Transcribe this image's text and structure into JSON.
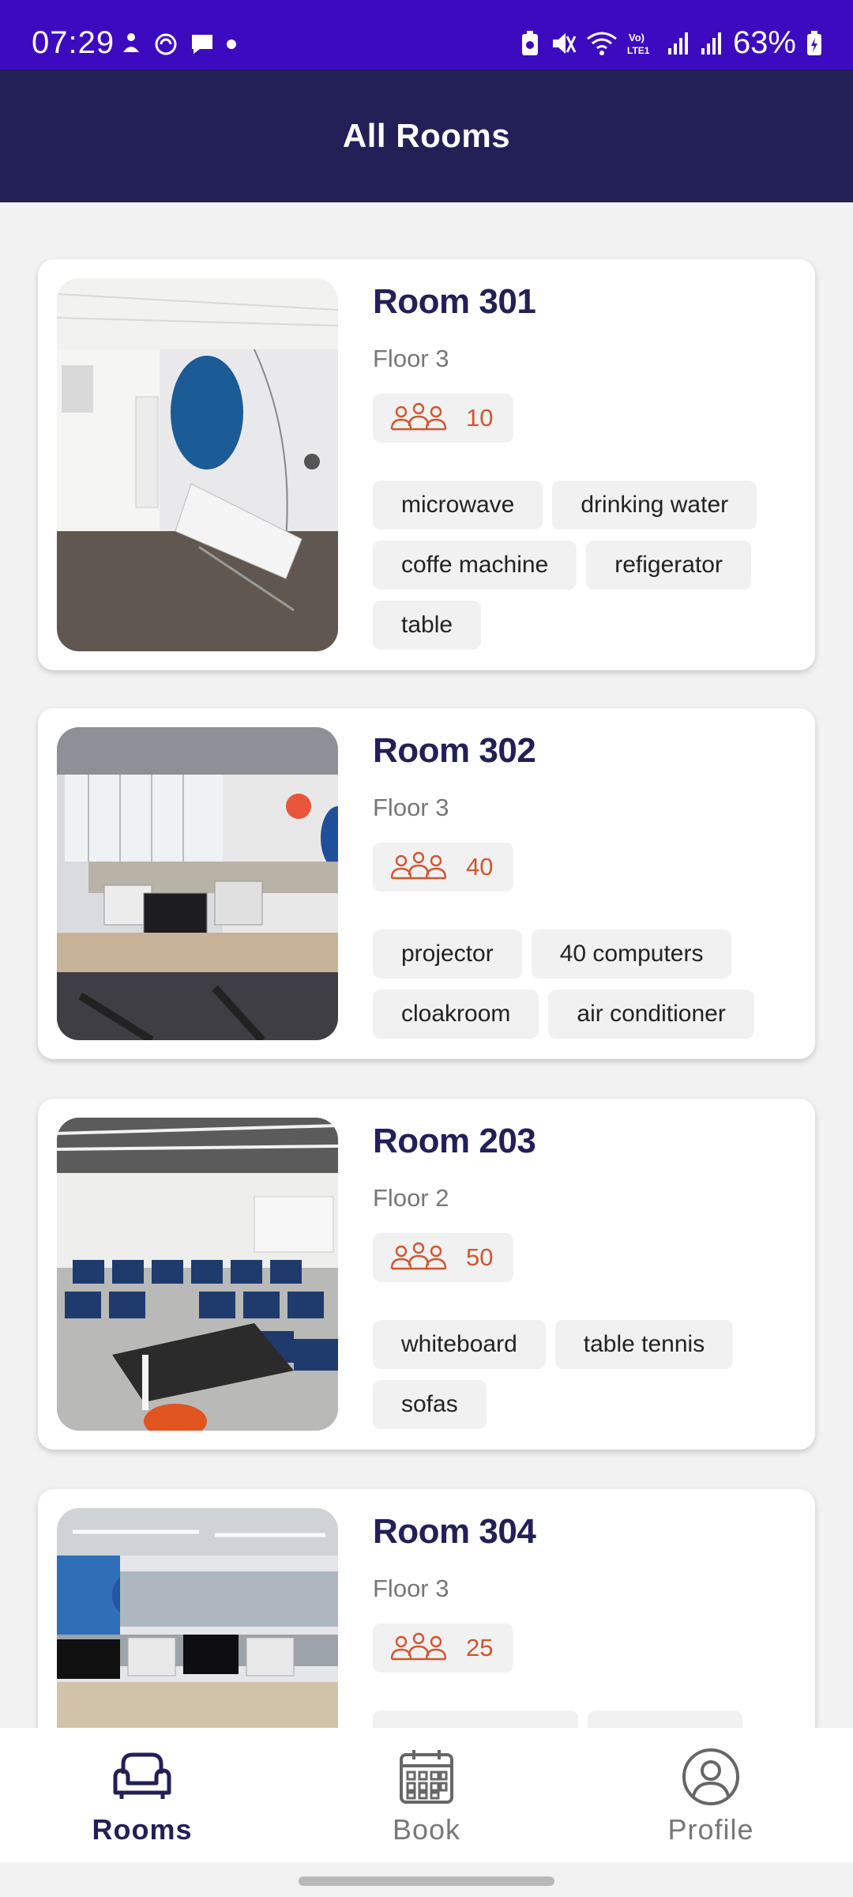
{
  "status_bar": {
    "time": "07:29",
    "battery": "63%",
    "left_icons": [
      "meditation-icon",
      "sync-icon",
      "message-icon",
      "dot-icon"
    ],
    "right_icons": [
      "battery-saver-icon",
      "mute-icon",
      "wifi-icon",
      "volte-icon",
      "signal-icon",
      "signal-icon",
      "battery-icon"
    ]
  },
  "app_bar": {
    "title": "All Rooms"
  },
  "rooms": [
    {
      "name": "Room 301",
      "floor": "Floor 3",
      "capacity": "10",
      "tags": [
        "microwave",
        "drinking water",
        "coffe machine",
        "refigerator",
        "table"
      ]
    },
    {
      "name": "Room 302",
      "floor": "Floor 3",
      "capacity": "40",
      "tags": [
        "projector",
        "40 computers",
        "cloakroom",
        "air conditioner"
      ]
    },
    {
      "name": "Room 203",
      "floor": "Floor 2",
      "capacity": "50",
      "tags": [
        "whiteboard",
        "table tennis",
        "sofas"
      ]
    },
    {
      "name": "Room 304",
      "floor": "Floor 3",
      "capacity": "25",
      "tags": []
    }
  ],
  "nav": {
    "rooms": "Rooms",
    "book": "Book",
    "profile": "Profile",
    "active": "Rooms"
  },
  "colors": {
    "status_bar": "#3d0bbf",
    "app_bar": "#222057",
    "accent": "#d0562f",
    "title": "#222057"
  }
}
